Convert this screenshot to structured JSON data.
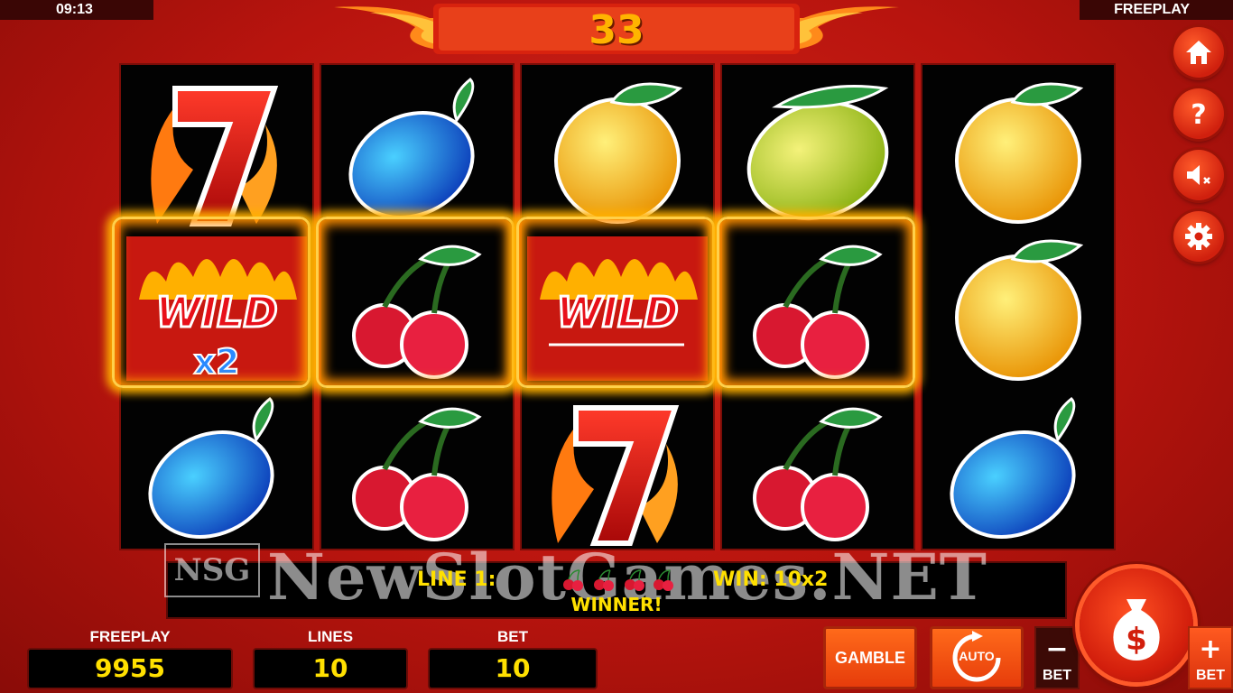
{
  "status_bar": {
    "time": "09:13",
    "mode": "FREEPLAY"
  },
  "header": {
    "counter": "33"
  },
  "sidebar": {
    "home": "home-icon",
    "help": "question-icon",
    "sound": "speaker-muted-icon",
    "settings": "gear-icon"
  },
  "reels": [
    [
      "seven",
      "wild-x2",
      "plum"
    ],
    [
      "plum",
      "cherry",
      "cherry"
    ],
    [
      "orange",
      "wild",
      "seven"
    ],
    [
      "lemon",
      "cherry",
      "cherry"
    ],
    [
      "orange",
      "orange",
      "plum"
    ]
  ],
  "symbols": {
    "wild_text": "WILD",
    "wild_multiplier": "x2"
  },
  "message": {
    "line": "LINE 1:",
    "win": "WIN: 10x2",
    "status": "WINNER!"
  },
  "watermark": {
    "logo": "NSG",
    "text": "NewSlotGames.NET"
  },
  "info": {
    "freeplay_label": "FREEPLAY",
    "freeplay_value": "9955",
    "lines_label": "LINES",
    "lines_value": "10",
    "bet_label": "BET",
    "bet_value": "10"
  },
  "controls": {
    "gamble": "GAMBLE",
    "auto": "AUTO",
    "minus": "−",
    "plus": "+",
    "bet_minus_label": "BET",
    "bet_plus_label": "BET"
  },
  "colors": {
    "accent": "#ffe000",
    "brand_red": "#c8180e",
    "button_orange": "#ff6a1a"
  }
}
